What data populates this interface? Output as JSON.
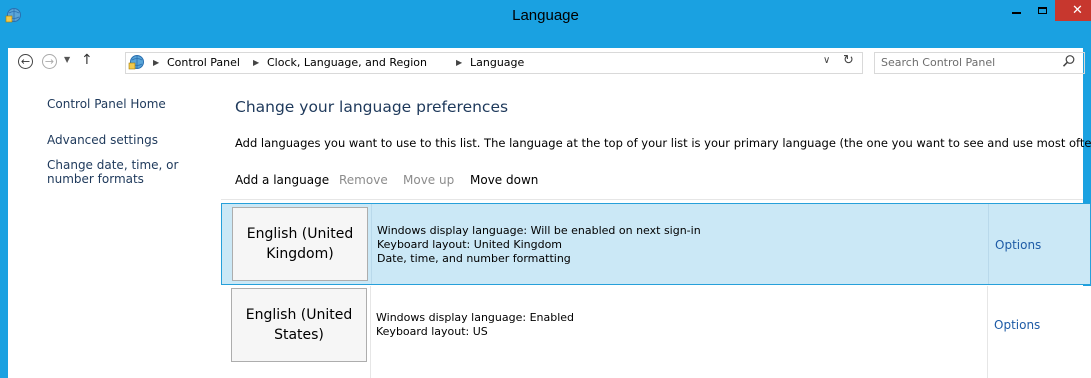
{
  "window": {
    "title": "Language",
    "close_glyph": "✕"
  },
  "nav": {
    "back_glyph": "←",
    "forward_glyph": "→",
    "recent_glyph": "▼",
    "up_glyph": "↑",
    "breadcrumb": [
      "Control Panel",
      "Clock, Language, and Region",
      "Language"
    ],
    "separator_glyph": "▶",
    "dropdown_glyph": "∨",
    "refresh_glyph": "↻",
    "search_placeholder": "Search Control Panel"
  },
  "sidebar": {
    "items": [
      {
        "label": "Control Panel Home"
      },
      {
        "label": "Advanced settings"
      },
      {
        "label": "Change date, time, or number formats"
      }
    ]
  },
  "main": {
    "heading": "Change your language preferences",
    "description": "Add languages you want to use to this list. The language at the top of your list is your primary language (the one you want to see and use most often).",
    "toolbar": {
      "add_label": "Add a language",
      "remove_label": "Remove",
      "move_up_label": "Move up",
      "move_down_label": "Move down"
    },
    "languages": [
      {
        "name": "English (United Kingdom)",
        "details": [
          "Windows display language: Will be enabled on next sign-in",
          "Keyboard layout: United Kingdom",
          "Date, time, and number formatting"
        ],
        "options_label": "Options",
        "selected": true
      },
      {
        "name": "English (United States)",
        "details": [
          "Windows display language: Enabled",
          "Keyboard layout: US"
        ],
        "options_label": "Options",
        "selected": false
      }
    ]
  },
  "colors": {
    "titlebar": "#1aa1e1",
    "link": "#1e395b",
    "selected_row": "#cbe8f6",
    "selected_border": "#26a0da",
    "close_button": "#c7372e"
  }
}
